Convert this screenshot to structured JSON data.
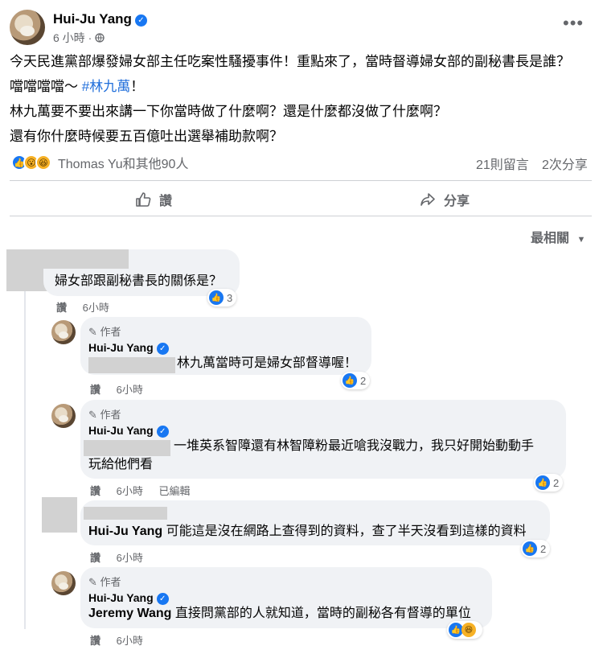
{
  "post": {
    "author": "Hui-Ju Yang",
    "time": "6 小時",
    "privacy_icon": "globe-icon",
    "paragraphs": [
      "今天民進黨部爆發婦女部主任吃案性騷擾事件！重點來了，當時督導婦女部的副秘書長是誰？",
      "林九萬要不要出來講一下你當時做了什麼啊？還是什麼都沒做了什麼啊？",
      "還有你什麼時候要五百億吐出選舉補助款啊？"
    ],
    "line2_prefix": "噹噹噹噹～ ",
    "line2_hashtag": "#林九萬",
    "line2_suffix": "！",
    "reactions_text": "Thomas Yu和其他90人",
    "comments_count": "21則留言",
    "shares_count": "2次分享"
  },
  "actions": {
    "like": "讚",
    "share": "分享"
  },
  "sort_label": "最相關",
  "comments": [
    {
      "text": "婦女部跟副秘書長的關係是？",
      "like": "讚",
      "time": "6小時",
      "reactions": "3"
    },
    {
      "tag": "作者",
      "name": "Hui-Ju Yang",
      "text": "林九萬當時可是婦女部督導喔！",
      "like": "讚",
      "time": "6小時",
      "reactions": "2"
    },
    {
      "tag": "作者",
      "name": "Hui-Ju Yang",
      "text_line1": "一堆英系智障還有林智障粉最近嗆我沒戰力，我只好開始動動手",
      "text_line2": "玩給他們看",
      "like": "讚",
      "time": "6小時",
      "edited": "已編輯",
      "reactions": "2"
    },
    {
      "mention": "Hui-Ju Yang",
      "text": "可能這是沒在網路上查得到的資料，查了半天沒看到這樣的資料",
      "like": "讚",
      "time": "6小時",
      "reactions": "2"
    },
    {
      "tag": "作者",
      "name": "Hui-Ju Yang",
      "mention": "Jeremy Wang",
      "text": "直接問黨部的人就知道，當時的副秘各有督導的單位",
      "like": "讚",
      "time": "6小時"
    }
  ],
  "colors": {
    "accent": "#1877f2",
    "hashtag": "#216fdb",
    "bubble": "#f0f2f5",
    "muted": "#65676b"
  }
}
